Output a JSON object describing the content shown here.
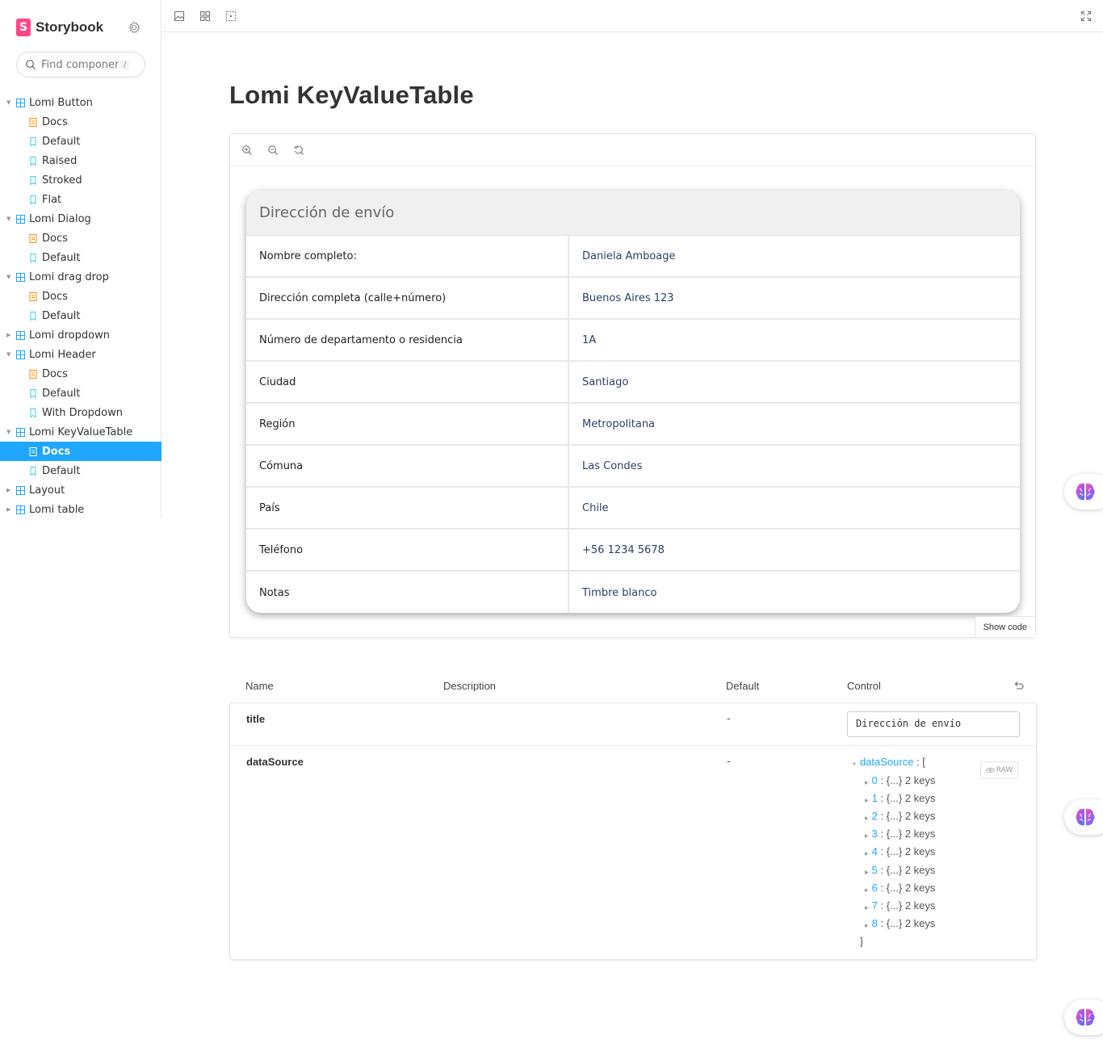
{
  "app": {
    "brand_name": "Storybook",
    "brand_logo_letter": "S",
    "brand_color": "#ff4785",
    "accent_color": "#1ea7fd"
  },
  "search": {
    "placeholder": "Find components",
    "shortcut": "/"
  },
  "sidebar": {
    "items": [
      {
        "type": "group",
        "label": "Lomi Button",
        "expanded": true
      },
      {
        "type": "docs",
        "label": "Docs"
      },
      {
        "type": "story",
        "label": "Default"
      },
      {
        "type": "story",
        "label": "Raised"
      },
      {
        "type": "story",
        "label": "Stroked"
      },
      {
        "type": "story",
        "label": "Flat"
      },
      {
        "type": "group",
        "label": "Lomi Dialog",
        "expanded": true
      },
      {
        "type": "docs",
        "label": "Docs"
      },
      {
        "type": "story",
        "label": "Default"
      },
      {
        "type": "group",
        "label": "Lomi drag drop",
        "expanded": true
      },
      {
        "type": "docs",
        "label": "Docs"
      },
      {
        "type": "story",
        "label": "Default"
      },
      {
        "type": "group",
        "label": "Lomi dropdown",
        "expanded": false
      },
      {
        "type": "group",
        "label": "Lomi Header",
        "expanded": true
      },
      {
        "type": "docs",
        "label": "Docs"
      },
      {
        "type": "story",
        "label": "Default"
      },
      {
        "type": "story",
        "label": "With Dropdown"
      },
      {
        "type": "group",
        "label": "Lomi KeyValueTable",
        "expanded": true
      },
      {
        "type": "docs",
        "label": "Docs",
        "selected": true
      },
      {
        "type": "story",
        "label": "Default"
      },
      {
        "type": "group",
        "label": "Layout",
        "expanded": false
      },
      {
        "type": "group",
        "label": "Lomi table",
        "expanded": false
      }
    ]
  },
  "main": {
    "title": "Lomi KeyValueTable"
  },
  "kv_table": {
    "title": "Dirección de envío",
    "rows": [
      {
        "key": "Nombre completo:",
        "value": "Daniela Amboage"
      },
      {
        "key": "Dirección completa (calle+número)",
        "value": "Buenos Aires 123"
      },
      {
        "key": "Número de departamento o residencia",
        "value": "1A"
      },
      {
        "key": "Ciudad",
        "value": "Santiago"
      },
      {
        "key": "Región",
        "value": "Metropolitana"
      },
      {
        "key": "Cómuna",
        "value": "Las Condes"
      },
      {
        "key": "País",
        "value": "Chile"
      },
      {
        "key": "Teléfono",
        "value": "+56 1234 5678"
      },
      {
        "key": "Notas",
        "value": "Timbre blanco"
      }
    ]
  },
  "preview": {
    "show_code_label": "Show code"
  },
  "args_table": {
    "headers": {
      "name": "Name",
      "description": "Description",
      "default": "Default",
      "control": "Control"
    },
    "rows": [
      {
        "name": "title",
        "default": "-",
        "control_value": "Dirección de envío"
      },
      {
        "name": "dataSource",
        "default": "-"
      }
    ],
    "raw_label": "RAW",
    "json_tree": {
      "root_key": "dataSource",
      "open_bracket": "[",
      "close_bracket": "]",
      "items": [
        {
          "index": "0",
          "summary": "{...} 2 keys"
        },
        {
          "index": "1",
          "summary": "{...} 2 keys"
        },
        {
          "index": "2",
          "summary": "{...} 2 keys"
        },
        {
          "index": "3",
          "summary": "{...} 2 keys"
        },
        {
          "index": "4",
          "summary": "{...} 2 keys"
        },
        {
          "index": "5",
          "summary": "{...} 2 keys"
        },
        {
          "index": "6",
          "summary": "{...} 2 keys"
        },
        {
          "index": "7",
          "summary": "{...} 2 keys"
        },
        {
          "index": "8",
          "summary": "{...} 2 keys"
        }
      ]
    }
  }
}
